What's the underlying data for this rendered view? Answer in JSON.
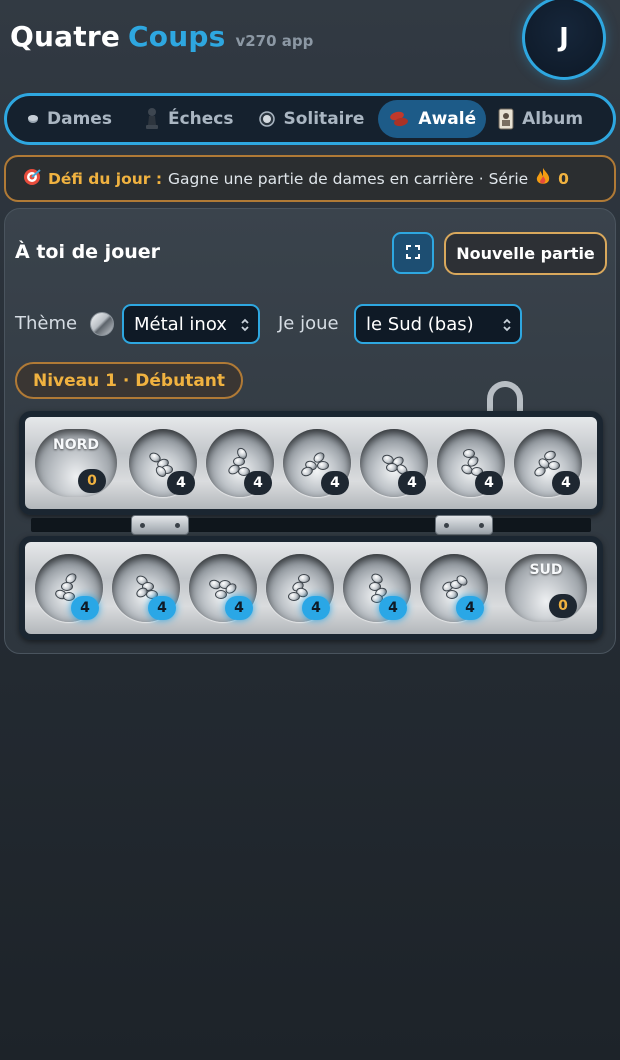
{
  "header": {
    "brand_first": "Quatre",
    "brand_second": "Coups",
    "version": "v270 app",
    "avatar_letter": "J"
  },
  "nav": {
    "tabs": [
      {
        "label": "Dames",
        "icon": "checker-piece-icon"
      },
      {
        "label": "Échecs",
        "icon": "chess-pawn-icon"
      },
      {
        "label": "Solitaire",
        "icon": "marble-icon"
      },
      {
        "label": "Awalé",
        "icon": "beans-icon",
        "active": true
      },
      {
        "label": "Album",
        "icon": "photo-card-icon"
      }
    ]
  },
  "challenge": {
    "icon": "target-icon",
    "label": "Défi du jour :",
    "text": "Gagne une partie de dames en carrière · Série",
    "streak_icon": "fire-icon",
    "streak": "0"
  },
  "game": {
    "turn": "À toi de jouer",
    "fullscreen_icon": "fullscreen-icon",
    "new_game": "Nouvelle partie",
    "theme_label": "Thème",
    "theme_value": "Métal inox",
    "side_label": "Je joue",
    "side_value": "le Sud (bas)",
    "level": "Niveau 1 · Débutant"
  },
  "board": {
    "north_store": {
      "label": "NORD",
      "count": "0"
    },
    "south_store": {
      "label": "SUD",
      "count": "0"
    },
    "north_pits": [
      "4",
      "4",
      "4",
      "4",
      "4",
      "4"
    ],
    "south_pits": [
      "4",
      "4",
      "4",
      "4",
      "4",
      "4"
    ]
  },
  "colors": {
    "accent": "#2ea7e0",
    "gold": "#f0b240",
    "background": "#262d35"
  }
}
